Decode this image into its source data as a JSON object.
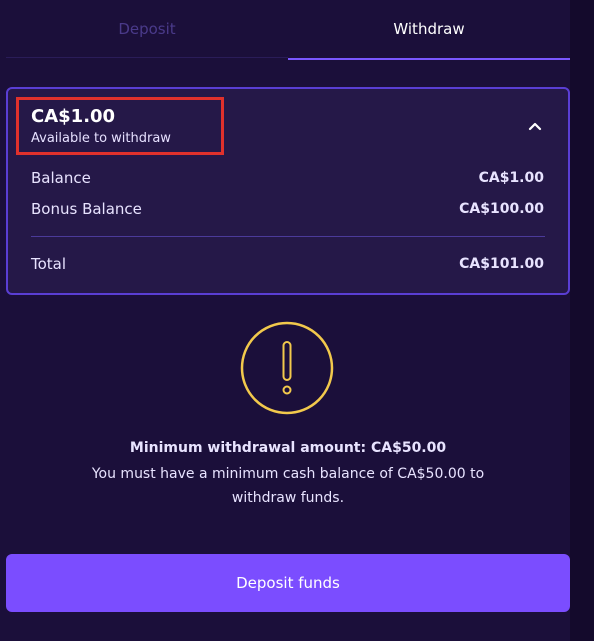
{
  "tabs": {
    "deposit": "Deposit",
    "withdraw": "Withdraw",
    "active": "Withdraw"
  },
  "summary": {
    "available_amount": "CA$1.00",
    "available_label": "Available to withdraw",
    "rows": [
      {
        "label": "Balance",
        "value": "CA$1.00"
      },
      {
        "label": "Bonus Balance",
        "value": "CA$100.00"
      }
    ],
    "total": {
      "label": "Total",
      "value": "CA$101.00"
    }
  },
  "notice": {
    "icon": "exclamation-icon",
    "title": "Minimum withdrawal amount: CA$50.00",
    "description": "You must have a minimum cash balance of CA$50.00 to withdraw funds."
  },
  "actions": {
    "deposit_funds": "Deposit funds"
  },
  "colors": {
    "background": "#1b0f3a",
    "accent": "#7b4dff",
    "warning": "#f2c94c",
    "highlight": "#e0312c"
  }
}
